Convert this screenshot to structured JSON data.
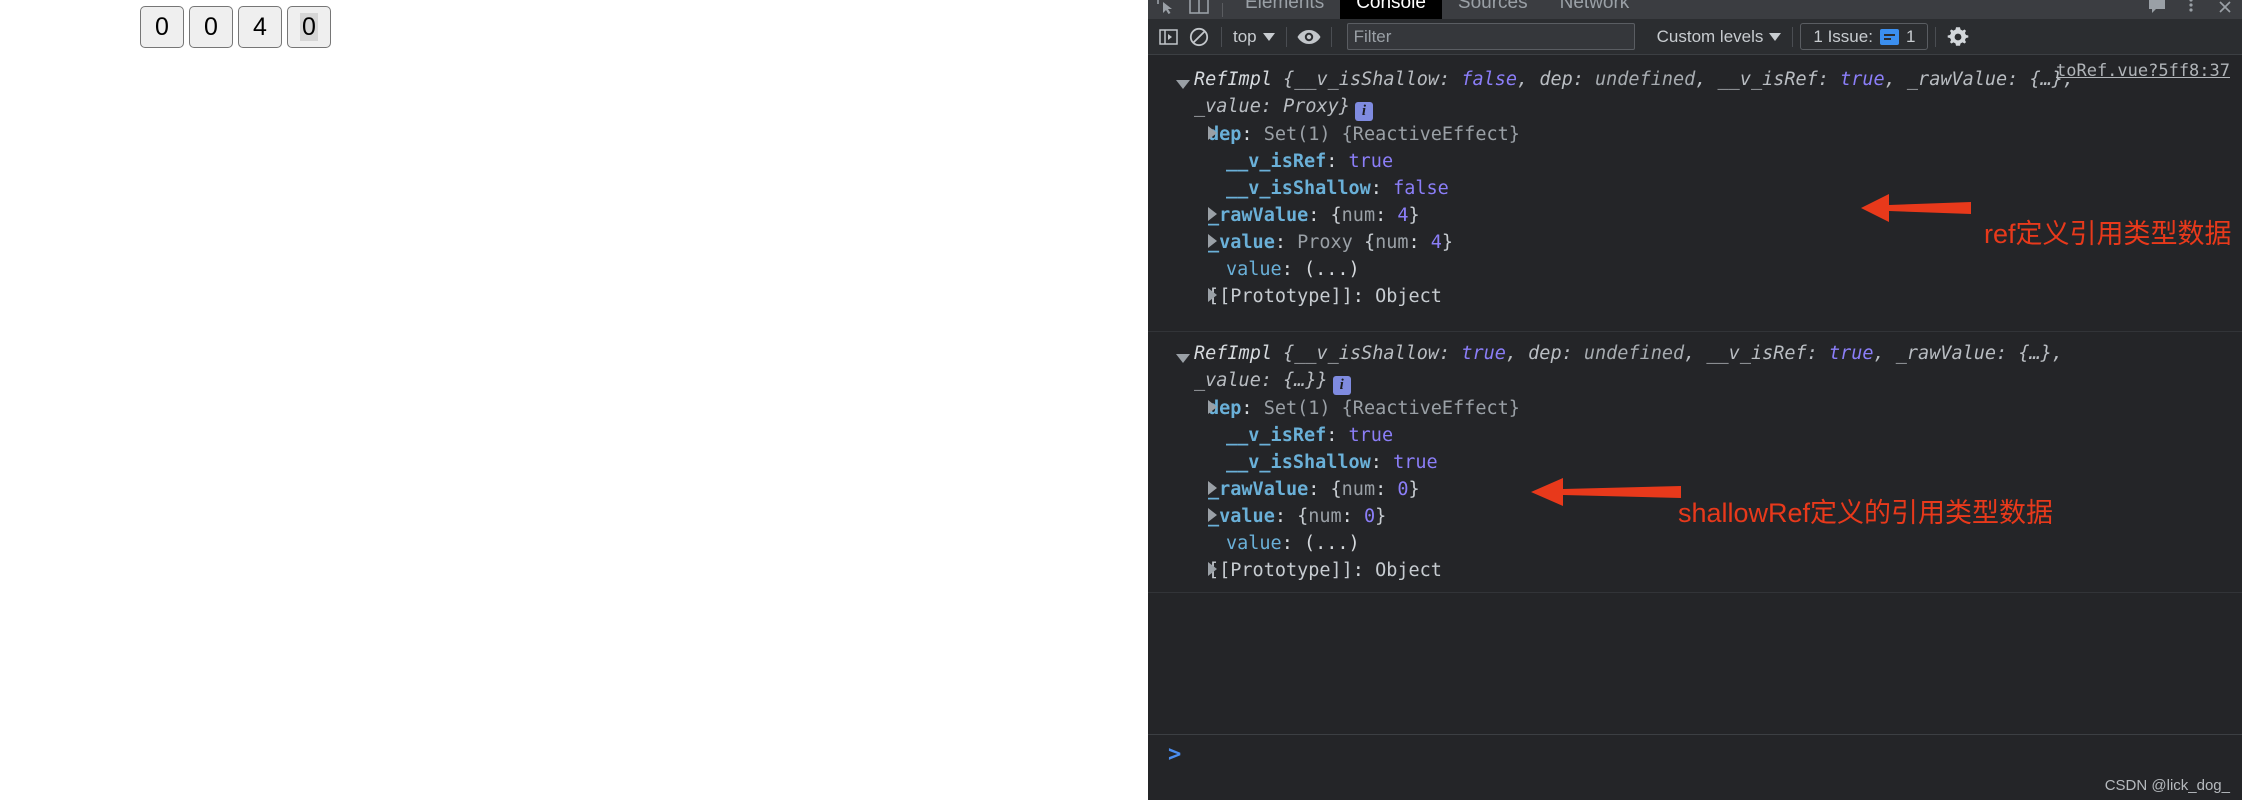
{
  "page": {
    "counters": [
      {
        "value": "0",
        "selected": false
      },
      {
        "value": "0",
        "selected": false
      },
      {
        "value": "4",
        "selected": false
      },
      {
        "value": "0",
        "selected": true
      }
    ]
  },
  "devtools": {
    "tabs": [
      {
        "label": "Elements",
        "active": false
      },
      {
        "label": "Console",
        "active": true
      },
      {
        "label": "Sources",
        "active": false
      },
      {
        "label": "Network",
        "active": false
      }
    ],
    "toolbar": {
      "sidebar_toggle": "show-console-sidebar-icon",
      "clear_console": "clear-console-icon",
      "context": "top",
      "eye": "live-expression-icon",
      "filter_placeholder": "Filter",
      "filter_value": "",
      "levels": "Custom levels",
      "issues_label": "1 Issue:",
      "issues_count": "1",
      "settings": "gear-icon"
    },
    "source_link": "toRef.vue?5ff8:37",
    "prompt": ">",
    "watermark": "CSDN @lick_dog_",
    "entries": [
      {
        "header_line1": "RefImpl {__v_isShallow: false, dep: undefined, __v_isRef: true, _raw",
        "header_line2": "Value: {…}, _value: Proxy}",
        "header_parts": {
          "ctor": "RefImpl",
          "open": "{",
          "k1": "__v_isShallow",
          "v1": "false",
          "k2": "dep",
          "v2": "undefined",
          "k3": "__v_isRef",
          "v3": "true",
          "k4": "_rawValue",
          "v4": "{…}",
          "k5": "_value",
          "v5": "Proxy",
          "close": "}"
        },
        "props": [
          {
            "expandable": true,
            "key": "dep",
            "sep": ": ",
            "value": "Set(1) {ReactiveEffect}",
            "kind": "obj"
          },
          {
            "expandable": false,
            "key": "__v_isRef",
            "sep": ": ",
            "value": "true",
            "kind": "bool"
          },
          {
            "expandable": false,
            "key": "__v_isShallow",
            "sep": ": ",
            "value": "false",
            "kind": "bool"
          },
          {
            "expandable": true,
            "key": "_rawValue",
            "sep": ": ",
            "value": "{num: 4}",
            "kind": "numobj",
            "num": "4"
          },
          {
            "expandable": true,
            "key": "_value",
            "sep": ": ",
            "value": "Proxy {num: 4}",
            "kind": "proxynumobj",
            "num": "4",
            "prefix": "Proxy "
          },
          {
            "expandable": false,
            "key": "value",
            "sep": ": ",
            "value": "(...)",
            "kind": "accessor"
          },
          {
            "expandable": true,
            "key": "[[Prototype]]",
            "sep": ": ",
            "value": "Object",
            "kind": "proto"
          }
        ],
        "annotation": "ref定义引用类型数据"
      },
      {
        "header_line1": "RefImpl {__v_isShallow: true, dep: undefined, __v_isRef: true, _rawV",
        "header_line2": "alue: {…}, _value: {…}}",
        "header_parts": {
          "ctor": "RefImpl",
          "open": "{",
          "k1": "__v_isShallow",
          "v1": "true",
          "k2": "dep",
          "v2": "undefined",
          "k3": "__v_isRef",
          "v3": "true",
          "k4": "_rawValue",
          "v4": "{…}",
          "k5": "_value",
          "v5": "{…}",
          "close": "}"
        },
        "props": [
          {
            "expandable": true,
            "key": "dep",
            "sep": ": ",
            "value": "Set(1) {ReactiveEffect}",
            "kind": "obj"
          },
          {
            "expandable": false,
            "key": "__v_isRef",
            "sep": ": ",
            "value": "true",
            "kind": "bool"
          },
          {
            "expandable": false,
            "key": "__v_isShallow",
            "sep": ": ",
            "value": "true",
            "kind": "bool"
          },
          {
            "expandable": true,
            "key": "_rawValue",
            "sep": ": ",
            "value": "{num: 0}",
            "kind": "numobj",
            "num": "0"
          },
          {
            "expandable": true,
            "key": "_value",
            "sep": ": ",
            "value": "{num: 0}",
            "kind": "numobj",
            "num": "0"
          },
          {
            "expandable": false,
            "key": "value",
            "sep": ": ",
            "value": "(...)",
            "kind": "accessor"
          },
          {
            "expandable": true,
            "key": "[[Prototype]]",
            "sep": ": ",
            "value": "Object",
            "kind": "proto"
          }
        ],
        "annotation": "shallowRef定义的引用类型数据"
      }
    ]
  }
}
